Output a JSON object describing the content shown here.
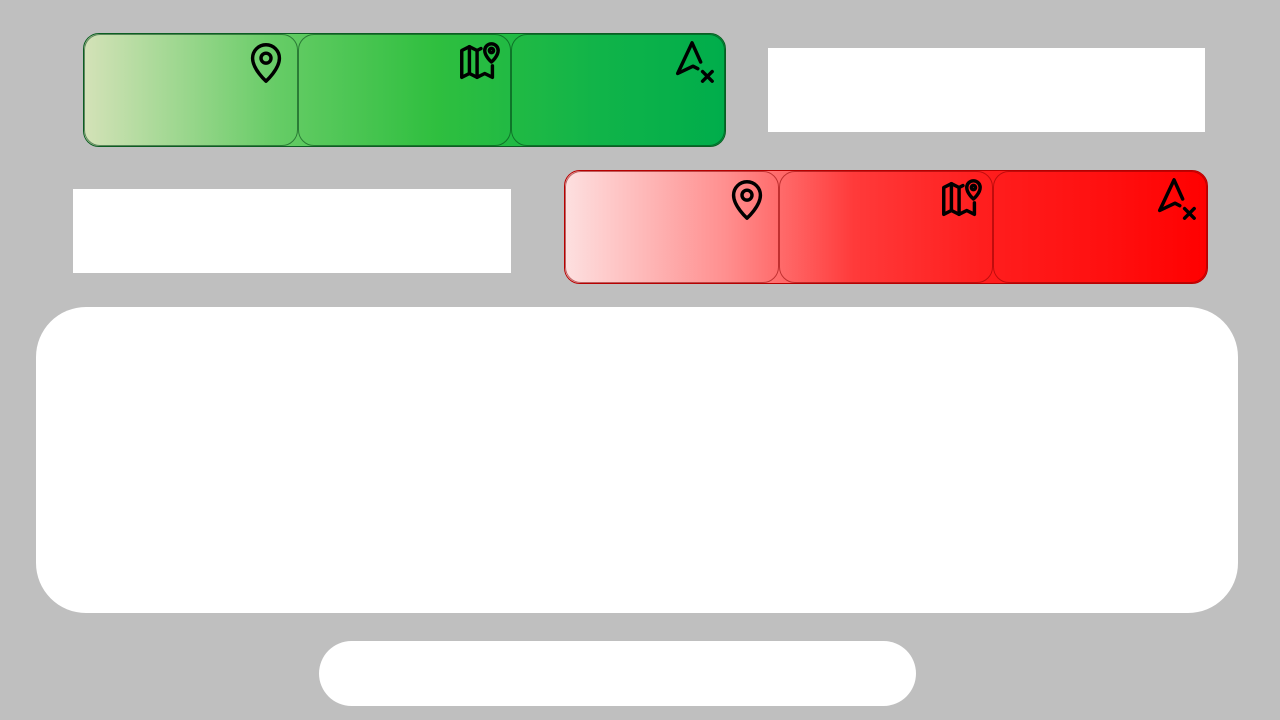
{
  "colors": {
    "background": "#bfbfbf",
    "panel": "#ffffff",
    "green_start": "#d4e2b8",
    "green_end": "#00ad4b",
    "red_start": "#fde0e0",
    "red_end": "#ff0000"
  },
  "green_group": {
    "segments": [
      {
        "icon": "map-pin-icon"
      },
      {
        "icon": "map-location-icon"
      },
      {
        "icon": "navigation-off-icon"
      }
    ]
  },
  "red_group": {
    "segments": [
      {
        "icon": "map-pin-icon"
      },
      {
        "icon": "map-location-icon"
      },
      {
        "icon": "navigation-off-icon"
      }
    ]
  }
}
